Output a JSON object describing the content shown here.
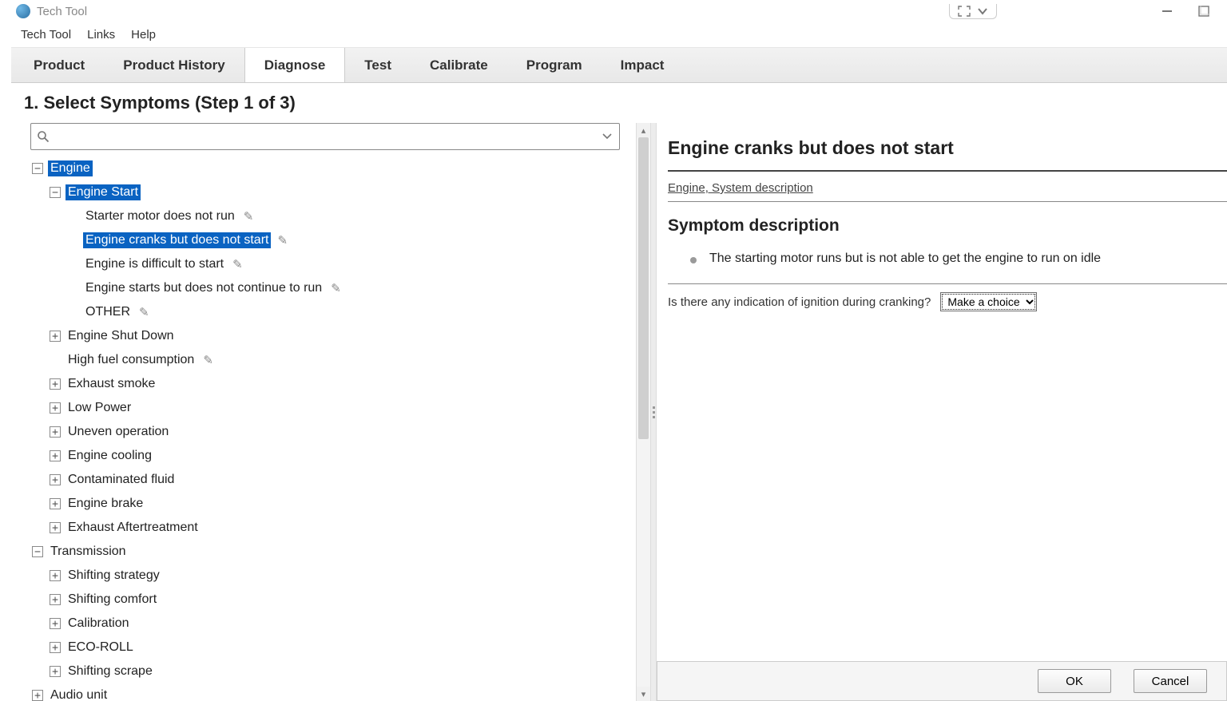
{
  "window": {
    "title": "Tech Tool"
  },
  "menubar": {
    "tech_tool": "Tech Tool",
    "links": "Links",
    "help": "Help"
  },
  "tabs": [
    {
      "id": "product",
      "label": "Product"
    },
    {
      "id": "product-history",
      "label": "Product History"
    },
    {
      "id": "diagnose",
      "label": "Diagnose"
    },
    {
      "id": "test",
      "label": "Test"
    },
    {
      "id": "calibrate",
      "label": "Calibrate"
    },
    {
      "id": "program",
      "label": "Program"
    },
    {
      "id": "impact",
      "label": "Impact"
    }
  ],
  "active_tab": "diagnose",
  "page": {
    "heading": "1. Select Symptoms (Step 1 of 3)"
  },
  "search": {
    "value": "",
    "placeholder": ""
  },
  "tree": {
    "engine": {
      "label": "Engine",
      "engine_start": {
        "label": "Engine Start",
        "items": [
          "Starter motor does not run",
          "Engine cranks but does not start",
          "Engine is difficult to start",
          "Engine starts but does not continue to run",
          "OTHER"
        ],
        "selected_index": 1
      },
      "engine_shut_down": "Engine Shut Down",
      "high_fuel_consumption": "High fuel consumption",
      "exhaust_smoke": "Exhaust smoke",
      "low_power": "Low Power",
      "uneven_operation": "Uneven operation",
      "engine_cooling": "Engine cooling",
      "contaminated_fluid": "Contaminated fluid",
      "engine_brake": "Engine brake",
      "exhaust_aftertreatment": "Exhaust Aftertreatment"
    },
    "transmission": {
      "label": "Transmission",
      "shifting_strategy": "Shifting strategy",
      "shifting_comfort": "Shifting comfort",
      "calibration": "Calibration",
      "eco_roll": "ECO-ROLL",
      "shifting_scrape": "Shifting scrape"
    },
    "audio_unit": "Audio unit"
  },
  "detail": {
    "title": "Engine cranks but does not start",
    "link": "Engine, System description",
    "subhead": "Symptom description",
    "bullet": "The starting motor runs but is not able to get the engine to run on idle",
    "question": "Is there any indication of ignition during cranking?",
    "select_default": "Make a choice"
  },
  "buttons": {
    "ok": "OK",
    "cancel": "Cancel"
  }
}
